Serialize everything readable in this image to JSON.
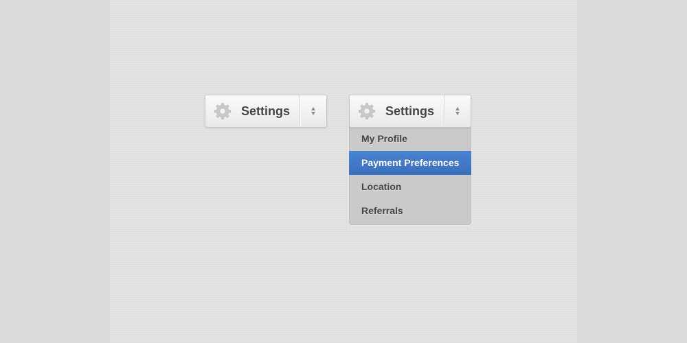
{
  "colors": {
    "accent": "#3f77c6",
    "menu_background": "#cacaca",
    "label_text": "#444444",
    "page_background": "#e4e4e2"
  },
  "dropdown_closed": {
    "icon": "gear-icon",
    "label": "Settings",
    "toggle_icon": "up-down-arrows-icon",
    "expanded": false
  },
  "dropdown_open": {
    "icon": "gear-icon",
    "label": "Settings",
    "toggle_icon": "up-down-arrows-icon",
    "expanded": true,
    "items": [
      {
        "label": "My Profile",
        "active": false
      },
      {
        "label": "Payment Preferences",
        "active": true
      },
      {
        "label": "Location",
        "active": false
      },
      {
        "label": "Referrals",
        "active": false
      }
    ]
  }
}
